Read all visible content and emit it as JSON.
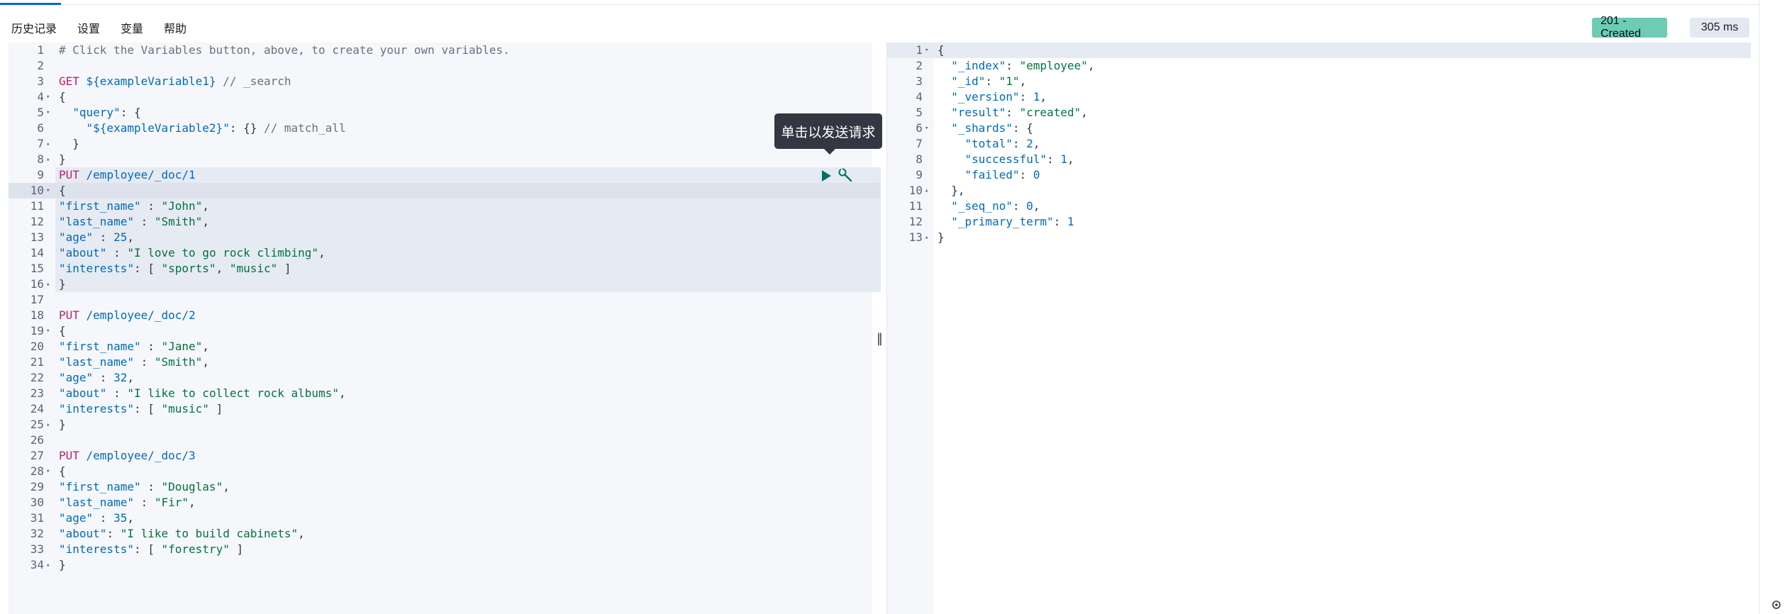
{
  "menu": {
    "history": "历史记录",
    "settings": "设置",
    "variables": "变量",
    "help": "帮助"
  },
  "status": {
    "code": "201 - Created",
    "time": "305 ms"
  },
  "tooltip": "单击以发送请求",
  "editor_lines": [
    {
      "n": "1",
      "fold": "",
      "t": [
        [
          "c-comment",
          "# Click the Variables button, above, to create your own variables."
        ]
      ]
    },
    {
      "n": "2",
      "fold": "",
      "t": []
    },
    {
      "n": "3",
      "fold": "",
      "t": [
        [
          "c-method",
          "GET"
        ],
        [
          "",
          ""
        ],
        [
          "c-url",
          " ${exampleVariable1}"
        ],
        [
          "c-comment",
          " // _search"
        ]
      ]
    },
    {
      "n": "4",
      "fold": "▾",
      "t": [
        [
          "",
          "{"
        ]
      ]
    },
    {
      "n": "5",
      "fold": "▾",
      "t": [
        [
          "c-key",
          "  \"query\""
        ],
        [
          "",
          ": {"
        ]
      ]
    },
    {
      "n": "6",
      "fold": "",
      "t": [
        [
          "c-key",
          "    \"${exampleVariable2}\""
        ],
        [
          "",
          ": {}"
        ],
        [
          "c-comment",
          " // match_all"
        ]
      ]
    },
    {
      "n": "7",
      "fold": "▴",
      "t": [
        [
          "",
          "  }"
        ]
      ]
    },
    {
      "n": "8",
      "fold": "▴",
      "t": [
        [
          "",
          "}"
        ]
      ]
    },
    {
      "n": "9",
      "fold": "",
      "t": [
        [
          "c-method",
          "PUT"
        ],
        [
          "c-url",
          " /employee/_doc/1"
        ]
      ]
    },
    {
      "n": "10",
      "fold": "▾",
      "t": [
        [
          "",
          "{"
        ]
      ]
    },
    {
      "n": "11",
      "fold": "",
      "t": [
        [
          "c-key",
          "\"first_name\""
        ],
        [
          "",
          " : "
        ],
        [
          "c-str",
          "\"John\""
        ],
        [
          "",
          ","
        ]
      ]
    },
    {
      "n": "12",
      "fold": "",
      "t": [
        [
          "c-key",
          "\"last_name\""
        ],
        [
          "",
          " : "
        ],
        [
          "c-str",
          "\"Smith\""
        ],
        [
          "",
          ","
        ]
      ]
    },
    {
      "n": "13",
      "fold": "",
      "t": [
        [
          "c-key",
          "\"age\""
        ],
        [
          "",
          " : "
        ],
        [
          "c-num",
          "25"
        ],
        [
          "",
          ","
        ]
      ]
    },
    {
      "n": "14",
      "fold": "",
      "t": [
        [
          "c-key",
          "\"about\""
        ],
        [
          "",
          " : "
        ],
        [
          "c-str",
          "\"I love to go rock climbing\""
        ],
        [
          "",
          ","
        ]
      ]
    },
    {
      "n": "15",
      "fold": "",
      "t": [
        [
          "c-key",
          "\"interests\""
        ],
        [
          "",
          ": [ "
        ],
        [
          "c-str",
          "\"sports\""
        ],
        [
          "",
          ", "
        ],
        [
          "c-str",
          "\"music\""
        ],
        [
          "",
          " ]"
        ]
      ]
    },
    {
      "n": "16",
      "fold": "▴",
      "t": [
        [
          "",
          "}"
        ]
      ]
    },
    {
      "n": "17",
      "fold": "",
      "t": []
    },
    {
      "n": "18",
      "fold": "",
      "t": [
        [
          "c-method",
          "PUT"
        ],
        [
          "c-url",
          " /employee/_doc/2"
        ]
      ]
    },
    {
      "n": "19",
      "fold": "▾",
      "t": [
        [
          "",
          "{"
        ]
      ]
    },
    {
      "n": "20",
      "fold": "",
      "t": [
        [
          "c-key",
          "\"first_name\""
        ],
        [
          "",
          " : "
        ],
        [
          "c-str",
          "\"Jane\""
        ],
        [
          "",
          ","
        ]
      ]
    },
    {
      "n": "21",
      "fold": "",
      "t": [
        [
          "c-key",
          "\"last_name\""
        ],
        [
          "",
          " : "
        ],
        [
          "c-str",
          "\"Smith\""
        ],
        [
          "",
          ","
        ]
      ]
    },
    {
      "n": "22",
      "fold": "",
      "t": [
        [
          "c-key",
          "\"age\""
        ],
        [
          "",
          " : "
        ],
        [
          "c-num",
          "32"
        ],
        [
          "",
          ","
        ]
      ]
    },
    {
      "n": "23",
      "fold": "",
      "t": [
        [
          "c-key",
          "\"about\""
        ],
        [
          "",
          " : "
        ],
        [
          "c-str",
          "\"I like to collect rock albums\""
        ],
        [
          "",
          ","
        ]
      ]
    },
    {
      "n": "24",
      "fold": "",
      "t": [
        [
          "c-key",
          "\"interests\""
        ],
        [
          "",
          ": [ "
        ],
        [
          "c-str",
          "\"music\""
        ],
        [
          "",
          " ]"
        ]
      ]
    },
    {
      "n": "25",
      "fold": "▴",
      "t": [
        [
          "",
          "}"
        ]
      ]
    },
    {
      "n": "26",
      "fold": "",
      "t": []
    },
    {
      "n": "27",
      "fold": "",
      "t": [
        [
          "c-method",
          "PUT"
        ],
        [
          "c-url",
          " /employee/_doc/3"
        ]
      ]
    },
    {
      "n": "28",
      "fold": "▾",
      "t": [
        [
          "",
          "{"
        ]
      ]
    },
    {
      "n": "29",
      "fold": "",
      "t": [
        [
          "c-key",
          "\"first_name\""
        ],
        [
          "",
          " : "
        ],
        [
          "c-str",
          "\"Douglas\""
        ],
        [
          "",
          ","
        ]
      ]
    },
    {
      "n": "30",
      "fold": "",
      "t": [
        [
          "c-key",
          "\"last_name\""
        ],
        [
          "",
          " : "
        ],
        [
          "c-str",
          "\"Fir\""
        ],
        [
          "",
          ","
        ]
      ]
    },
    {
      "n": "31",
      "fold": "",
      "t": [
        [
          "c-key",
          "\"age\""
        ],
        [
          "",
          " : "
        ],
        [
          "c-num",
          "35"
        ],
        [
          "",
          ","
        ]
      ]
    },
    {
      "n": "32",
      "fold": "",
      "t": [
        [
          "c-key",
          "\"about\""
        ],
        [
          "",
          ": "
        ],
        [
          "c-str",
          "\"I like to build cabinets\""
        ],
        [
          "",
          ","
        ]
      ]
    },
    {
      "n": "33",
      "fold": "",
      "t": [
        [
          "c-key",
          "\"interests\""
        ],
        [
          "",
          ": [ "
        ],
        [
          "c-str",
          "\"forestry\""
        ],
        [
          "",
          " ]"
        ]
      ]
    },
    {
      "n": "34",
      "fold": "▴",
      "t": [
        [
          "",
          "}"
        ]
      ]
    }
  ],
  "output_lines": [
    {
      "n": "1",
      "fold": "▾",
      "t": [
        [
          "",
          "{"
        ]
      ]
    },
    {
      "n": "2",
      "fold": "",
      "t": [
        [
          "c-key",
          "  \"_index\""
        ],
        [
          "",
          ": "
        ],
        [
          "c-str",
          "\"employee\""
        ],
        [
          "",
          ","
        ]
      ]
    },
    {
      "n": "3",
      "fold": "",
      "t": [
        [
          "c-key",
          "  \"_id\""
        ],
        [
          "",
          ": "
        ],
        [
          "c-str",
          "\"1\""
        ],
        [
          "",
          ","
        ]
      ]
    },
    {
      "n": "4",
      "fold": "",
      "t": [
        [
          "c-key",
          "  \"_version\""
        ],
        [
          "",
          ": "
        ],
        [
          "c-num",
          "1"
        ],
        [
          "",
          ","
        ]
      ]
    },
    {
      "n": "5",
      "fold": "",
      "t": [
        [
          "c-key",
          "  \"result\""
        ],
        [
          "",
          ": "
        ],
        [
          "c-str",
          "\"created\""
        ],
        [
          "",
          ","
        ]
      ]
    },
    {
      "n": "6",
      "fold": "▾",
      "t": [
        [
          "c-key",
          "  \"_shards\""
        ],
        [
          "",
          ": {"
        ]
      ]
    },
    {
      "n": "7",
      "fold": "",
      "t": [
        [
          "c-key",
          "    \"total\""
        ],
        [
          "",
          ": "
        ],
        [
          "c-num",
          "2"
        ],
        [
          "",
          ","
        ]
      ]
    },
    {
      "n": "8",
      "fold": "",
      "t": [
        [
          "c-key",
          "    \"successful\""
        ],
        [
          "",
          ": "
        ],
        [
          "c-num",
          "1"
        ],
        [
          "",
          ","
        ]
      ]
    },
    {
      "n": "9",
      "fold": "",
      "t": [
        [
          "c-key",
          "    \"failed\""
        ],
        [
          "",
          ": "
        ],
        [
          "c-num",
          "0"
        ]
      ]
    },
    {
      "n": "10",
      "fold": "▴",
      "t": [
        [
          "",
          "  },"
        ]
      ]
    },
    {
      "n": "11",
      "fold": "",
      "t": [
        [
          "c-key",
          "  \"_seq_no\""
        ],
        [
          "",
          ": "
        ],
        [
          "c-num",
          "0"
        ],
        [
          "",
          ","
        ]
      ]
    },
    {
      "n": "12",
      "fold": "",
      "t": [
        [
          "c-key",
          "  \"_primary_term\""
        ],
        [
          "",
          ": "
        ],
        [
          "c-num",
          "1"
        ]
      ]
    },
    {
      "n": "13",
      "fold": "▴",
      "t": [
        [
          "",
          "}"
        ]
      ]
    }
  ]
}
